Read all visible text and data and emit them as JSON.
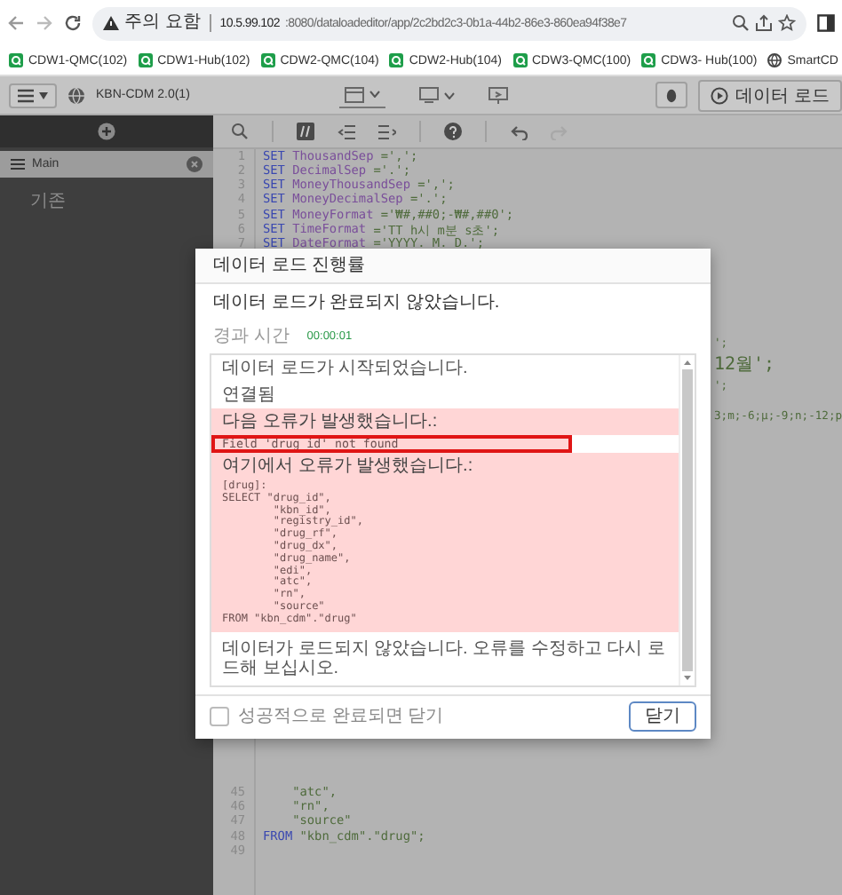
{
  "browser": {
    "warning": "주의 요함",
    "url_host": "10.5.99.102",
    "url_path": ":8080/dataloadeditor/app/2c2bd2c3-0b1a-44b2-86e3-860ea94f38e7"
  },
  "bookmarks": [
    {
      "kind": "app",
      "label": "CDW1-QMC(102)"
    },
    {
      "kind": "app",
      "label": "CDW1-Hub(102)"
    },
    {
      "kind": "app",
      "label": "CDW2-QMC(104)"
    },
    {
      "kind": "app",
      "label": "CDW2-Hub(104)"
    },
    {
      "kind": "app",
      "label": "CDW3-QMC(100)"
    },
    {
      "kind": "app",
      "label": "CDW3- Hub(100)"
    },
    {
      "kind": "web",
      "label": "SmartCD"
    }
  ],
  "app_toolbar": {
    "app_name": "KBN-CDM 2.0(1)",
    "load_button": "데이터 로드"
  },
  "sidebar": {
    "section": "Main",
    "items": [
      "기존"
    ]
  },
  "editor": {
    "lines": [
      {
        "kind": "line",
        "number": "1",
        "tokens": [
          {
            "kind": "keyword",
            "text": "SET"
          },
          {
            "kind": "name",
            "text": "ThousandSep"
          },
          {
            "kind": "string",
            "text": "=',';"
          }
        ]
      },
      {
        "kind": "line",
        "number": "2",
        "tokens": [
          {
            "kind": "keyword",
            "text": "SET"
          },
          {
            "kind": "name",
            "text": "DecimalSep"
          },
          {
            "kind": "string",
            "text": "='.';"
          }
        ]
      },
      {
        "kind": "line",
        "number": "3",
        "tokens": [
          {
            "kind": "keyword",
            "text": "SET"
          },
          {
            "kind": "name",
            "text": "MoneyThousandSep"
          },
          {
            "kind": "string",
            "text": "=',';"
          }
        ]
      },
      {
        "kind": "line",
        "number": "4",
        "tokens": [
          {
            "kind": "keyword",
            "text": "SET"
          },
          {
            "kind": "name",
            "text": "MoneyDecimalSep"
          },
          {
            "kind": "string",
            "text": "='.';"
          }
        ]
      },
      {
        "kind": "line",
        "number": "5",
        "tokens": [
          {
            "kind": "keyword",
            "text": "SET"
          },
          {
            "kind": "name",
            "text": "MoneyFormat"
          },
          {
            "kind": "string",
            "text": "='₩#,##0;-₩#,##0';"
          }
        ]
      },
      {
        "kind": "line",
        "number": "6",
        "tokens": [
          {
            "kind": "keyword",
            "text": "SET"
          },
          {
            "kind": "name",
            "text": "TimeFormat"
          },
          {
            "kind": "string",
            "text": "='TT h시 m분 s초';"
          }
        ]
      },
      {
        "kind": "line",
        "number": "7",
        "tokens": [
          {
            "kind": "keyword",
            "text": "SET"
          },
          {
            "kind": "name",
            "text": "DateFormat"
          },
          {
            "kind": "string",
            "text": "='YYYY. M. D.';"
          }
        ]
      },
      {
        "kind": "covered"
      },
      {
        "kind": "covered"
      },
      {
        "kind": "covered"
      },
      {
        "kind": "covered"
      },
      {
        "kind": "covered"
      },
      {
        "kind": "covered"
      },
      {
        "kind": "covered",
        "tail": "';"
      },
      {
        "kind": "covered",
        "tail": "12월';"
      },
      {
        "kind": "covered"
      },
      {
        "kind": "covered",
        "tail": "';"
      },
      {
        "kind": "covered"
      },
      {
        "kind": "covered",
        "tail": "3;m;-6;μ;-9;n;-12;p"
      },
      {
        "kind": "covered"
      },
      {
        "kind": "covered"
      },
      {
        "kind": "covered"
      },
      {
        "kind": "covered"
      },
      {
        "kind": "covered"
      },
      {
        "kind": "covered"
      },
      {
        "kind": "covered"
      },
      {
        "kind": "covered"
      },
      {
        "kind": "covered"
      },
      {
        "kind": "covered"
      },
      {
        "kind": "covered"
      },
      {
        "kind": "covered"
      },
      {
        "kind": "covered"
      },
      {
        "kind": "covered"
      },
      {
        "kind": "covered"
      },
      {
        "kind": "covered"
      },
      {
        "kind": "covered"
      },
      {
        "kind": "covered"
      },
      {
        "kind": "covered"
      },
      {
        "kind": "covered"
      },
      {
        "kind": "covered"
      },
      {
        "kind": "covered"
      },
      {
        "kind": "covered"
      },
      {
        "kind": "covered"
      },
      {
        "kind": "covered"
      },
      {
        "kind": "line",
        "number": "45",
        "tokens": [
          {
            "kind": "string",
            "text": "    \"atc\","
          }
        ]
      },
      {
        "kind": "line",
        "number": "46",
        "tokens": [
          {
            "kind": "string",
            "text": "    \"rn\","
          }
        ]
      },
      {
        "kind": "line",
        "number": "47",
        "tokens": [
          {
            "kind": "string",
            "text": "    \"source\""
          }
        ]
      },
      {
        "kind": "line",
        "number": "48",
        "tokens": [
          {
            "kind": "keyword",
            "text": "FROM"
          },
          {
            "kind": "string",
            "text": "\"kbn_cdm\".\"drug\";"
          }
        ]
      },
      {
        "kind": "line",
        "number": "49"
      }
    ]
  },
  "dialog": {
    "title": "데이터 로드 진행률",
    "message": "데이터 로드가 완료되지 않았습니다.",
    "elapsed_label": "경과 시간",
    "elapsed": "00:00:01",
    "log": [
      {
        "kind": "info",
        "text": "데이터 로드가 시작되었습니다.",
        "highlighted": false
      },
      {
        "kind": "info",
        "text": "연결됨",
        "highlighted": false
      },
      {
        "kind": "error",
        "text": "다음 오류가 발생했습니다.:",
        "highlighted": false
      },
      {
        "kind": "error-detail",
        "text": "Field 'drug_id' not found",
        "highlighted": true
      },
      {
        "kind": "error",
        "text": "여기에서 오류가 발생했습니다.:",
        "highlighted": false
      },
      {
        "kind": "error-code",
        "text": "[drug]:\nSELECT \"drug_id\",\n        \"kbn_id\",\n        \"registry_id\",\n        \"drug_rf\",\n        \"drug_dx\",\n        \"drug_name\",\n        \"edi\",\n        \"atc\",\n        \"rn\",\n        \"source\"\nFROM \"kbn_cdm\".\"drug\"",
        "highlighted": false
      },
      {
        "kind": "info",
        "text": "데이터가 로드되지 않았습니다. 오류를 수정하고 다시 로드해 보십시오.",
        "highlighted": false
      }
    ],
    "close_when_done": {
      "label": "성공적으로 완료되면 닫기",
      "checked": false
    },
    "close_button": "닫기"
  }
}
